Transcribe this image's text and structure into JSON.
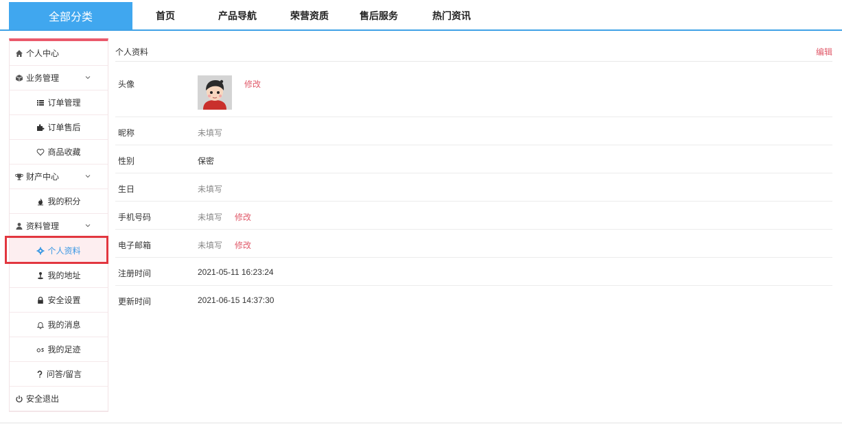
{
  "topnav": {
    "all_categories": "全部分类",
    "links": [
      "首页",
      "产品导航",
      "荣营资质",
      "售后服务",
      "热门资讯"
    ]
  },
  "sidebar": {
    "personal_center": "个人中心",
    "business": {
      "label": "业务管理",
      "items": [
        "订单管理",
        "订单售后",
        "商品收藏"
      ]
    },
    "assets": {
      "label": "财产中心",
      "items": [
        "我的积分"
      ]
    },
    "profile": {
      "label": "资料管理",
      "items": [
        "个人资料",
        "我的地址",
        "安全设置",
        "我的消息",
        "我的足迹",
        "问答/留言"
      ]
    },
    "logout": "安全退出"
  },
  "profile": {
    "title": "个人资料",
    "edit": "编辑",
    "modify": "修改",
    "avatar_label": "头像",
    "fields": [
      {
        "label": "昵称",
        "value": "未填写"
      },
      {
        "label": "性别",
        "value": "保密"
      },
      {
        "label": "生日",
        "value": "未填写"
      },
      {
        "label": "手机号码",
        "value": "未填写"
      },
      {
        "label": "电子邮箱",
        "value": "未填写"
      },
      {
        "label": "注册时间",
        "value": "2021-05-11 16:23:24"
      },
      {
        "label": "更新时间",
        "value": "2021-06-15 14:37:30"
      }
    ]
  },
  "colors": {
    "accent_blue": "#40a7ef",
    "accent_red": "#ea5a6b",
    "link_red": "#e05a6a"
  }
}
